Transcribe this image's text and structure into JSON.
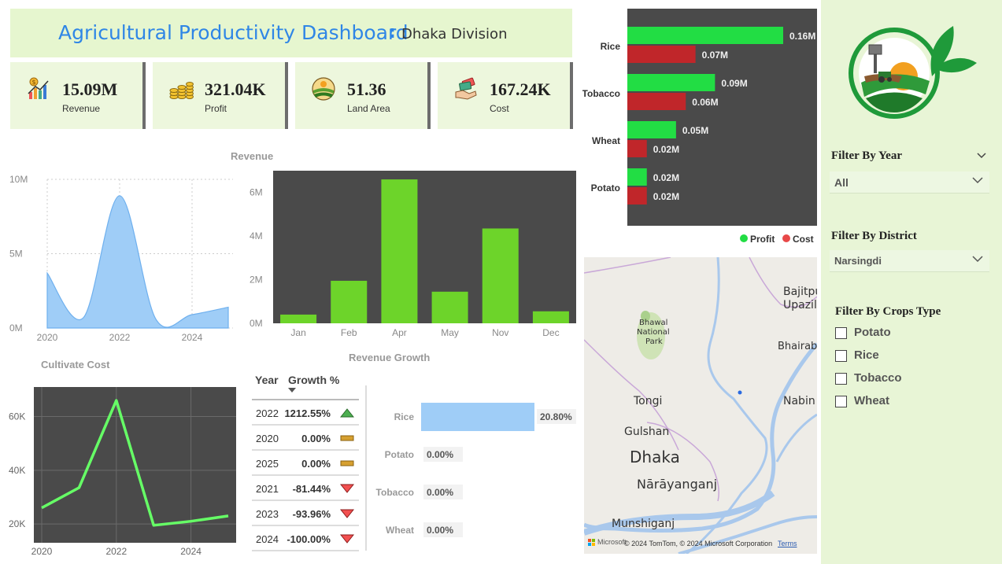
{
  "header": {
    "title": "Agricultural Productivity Dashboard",
    "colon": ":",
    "subtitle": "Dhaka Division"
  },
  "kpis": [
    {
      "value": "15.09M",
      "label": "Revenue",
      "icon": "revenue-chart-icon"
    },
    {
      "value": "321.04K",
      "label": "Profit",
      "icon": "coins-icon"
    },
    {
      "value": "51.36",
      "label": "Land Area",
      "icon": "land-field-icon"
    },
    {
      "value": "167.24K",
      "label": "Cost",
      "icon": "cost-hand-icon"
    }
  ],
  "colors": {
    "profit": "#22dd44",
    "cost": "#c0262a",
    "revenue_bar": "#6dd42a",
    "area_fill": "#9fcdf7",
    "line_green": "#66ff66",
    "growth_bar": "#9fcdf7",
    "header_bg": "#e6f6cf",
    "panel_bg": "#e8f5d6"
  },
  "chart_data": [
    {
      "id": "revenue-area",
      "type": "area",
      "title": "Revenue",
      "x": [
        2020,
        2021,
        2022,
        2023,
        2024,
        2025
      ],
      "values": [
        3700000,
        700000,
        8900000,
        600000,
        900000,
        1400000
      ],
      "xticks": [
        "2020",
        "2022",
        "2024"
      ],
      "yticks": [
        "0M",
        "5M",
        "10M"
      ],
      "ylim": [
        0,
        10000000
      ],
      "grid": true
    },
    {
      "id": "revenue-monthly",
      "type": "bar",
      "title": "",
      "categories": [
        "Jan",
        "Feb",
        "Apr",
        "May",
        "Nov",
        "Dec"
      ],
      "values": [
        400000,
        1950000,
        6600000,
        1450000,
        4350000,
        550000
      ],
      "yticks": [
        "0M",
        "2M",
        "4M",
        "6M"
      ],
      "ylim": [
        0,
        7000000
      ]
    },
    {
      "id": "cultivate-cost",
      "type": "line",
      "title": "Cultivate  Cost",
      "x": [
        2020,
        2021,
        2022,
        2023,
        2024,
        2025
      ],
      "values": [
        26000,
        33500,
        66000,
        19500,
        21000,
        23000
      ],
      "xticks": [
        "2020",
        "2022",
        "2024"
      ],
      "yticks": [
        "20K",
        "40K",
        "60K"
      ],
      "ylim": [
        13000,
        71000
      ],
      "grid": true
    },
    {
      "id": "profit-cost",
      "type": "bar",
      "orientation": "horizontal",
      "categories": [
        "Rice",
        "Tobacco",
        "Wheat",
        "Potato"
      ],
      "series": [
        {
          "name": "Profit",
          "values": [
            0.16,
            0.09,
            0.05,
            0.02
          ],
          "labels": [
            "0.16M",
            "0.09M",
            "0.05M",
            "0.02M"
          ]
        },
        {
          "name": "Cost",
          "values": [
            0.07,
            0.06,
            0.02,
            0.02
          ],
          "labels": [
            "0.07M",
            "0.06M",
            "0.02M",
            "0.02M"
          ]
        }
      ],
      "legend": "bottom-right"
    },
    {
      "id": "crop-growth",
      "type": "bar",
      "orientation": "horizontal",
      "categories": [
        "Rice",
        "Potato",
        "Tobacco",
        "Wheat"
      ],
      "values": [
        20.8,
        0,
        0,
        0
      ],
      "labels": [
        "20.80%",
        "0.00%",
        "0.00%",
        "0.00%"
      ]
    }
  ],
  "growth": {
    "title": "Revenue Growth",
    "col_year": "Year",
    "col_growth": "Growth %",
    "rows": [
      {
        "year": "2022",
        "growth": "1212.55%",
        "trend": "up"
      },
      {
        "year": "2020",
        "growth": "0.00%",
        "trend": "flat"
      },
      {
        "year": "2025",
        "growth": "0.00%",
        "trend": "flat"
      },
      {
        "year": "2021",
        "growth": "-81.44%",
        "trend": "down"
      },
      {
        "year": "2023",
        "growth": "-93.96%",
        "trend": "down"
      },
      {
        "year": "2024",
        "growth": "-100.00%",
        "trend": "down"
      }
    ]
  },
  "map": {
    "labels": {
      "bajitpur": "Bajitpu",
      "upazila": "Upazil",
      "bhairab": "Bhairab",
      "bhawal": "Bhawal",
      "national": "National",
      "park": "Park",
      "tongi": "Tongi",
      "nabin": "Nabin",
      "gulshan": "Gulshan",
      "dhaka": "Dhaka",
      "narayanganj": "Nārāyanganj",
      "munshiganj": "Munshiganj"
    },
    "attribution": "© 2024 TomTom, © 2024 Microsoft Corporation",
    "terms": "Terms",
    "brand": "Microsoft"
  },
  "filters": {
    "year_label": "Filter By Year",
    "year_value": "All",
    "district_label": "Filter By District",
    "district_value": "Narsingdi",
    "crops_label": "Filter By Crops Type",
    "crops": [
      "Potato",
      "Rice",
      "Tobacco",
      "Wheat"
    ]
  }
}
